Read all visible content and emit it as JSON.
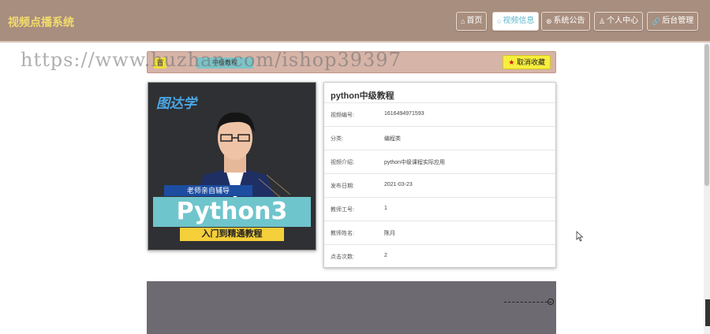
{
  "header": {
    "brand": "视频点播系统",
    "nav": [
      {
        "icon": "home-icon",
        "glyph": "⌂",
        "label": "首页"
      },
      {
        "icon": "video-icon",
        "glyph": "○",
        "label": "视频信息"
      },
      {
        "icon": "announcement-icon",
        "glyph": "⊛",
        "label": "系统公告"
      },
      {
        "icon": "user-icon",
        "glyph": "♙",
        "label": "个人中心"
      },
      {
        "icon": "link-icon",
        "glyph": "🔗",
        "label": "后台管理"
      }
    ]
  },
  "breadcrumb": {
    "home": "首",
    "current": "中级教程"
  },
  "favorite_button": "取消收藏",
  "watermark": "https://www.huzhan.com/ishop39397",
  "cover": {
    "logo": "图达学",
    "tagline": "老师亲自辅导",
    "title": "Python3",
    "subtitle": "入门到精通教程"
  },
  "video": {
    "title": "python中级教程",
    "fields": [
      {
        "label": "视频编号:",
        "value": "1616494971593"
      },
      {
        "label": "分类:",
        "value": "编程类"
      },
      {
        "label": "视频介绍:",
        "value": "python中级课程实际应用"
      },
      {
        "label": "发布日期:",
        "value": "2021-03-23"
      },
      {
        "label": "教师工号:",
        "value": "1"
      },
      {
        "label": "教师姓名:",
        "value": "陈月"
      },
      {
        "label": "点击次数:",
        "value": "2"
      }
    ]
  },
  "colors": {
    "header_bg": "#a88e7e",
    "brand": "#f3dc6d",
    "active_nav_text": "#5fb6c9",
    "breadcrumb_bg": "#d6b4a8",
    "favorite_bg": "#f7ef3e"
  }
}
